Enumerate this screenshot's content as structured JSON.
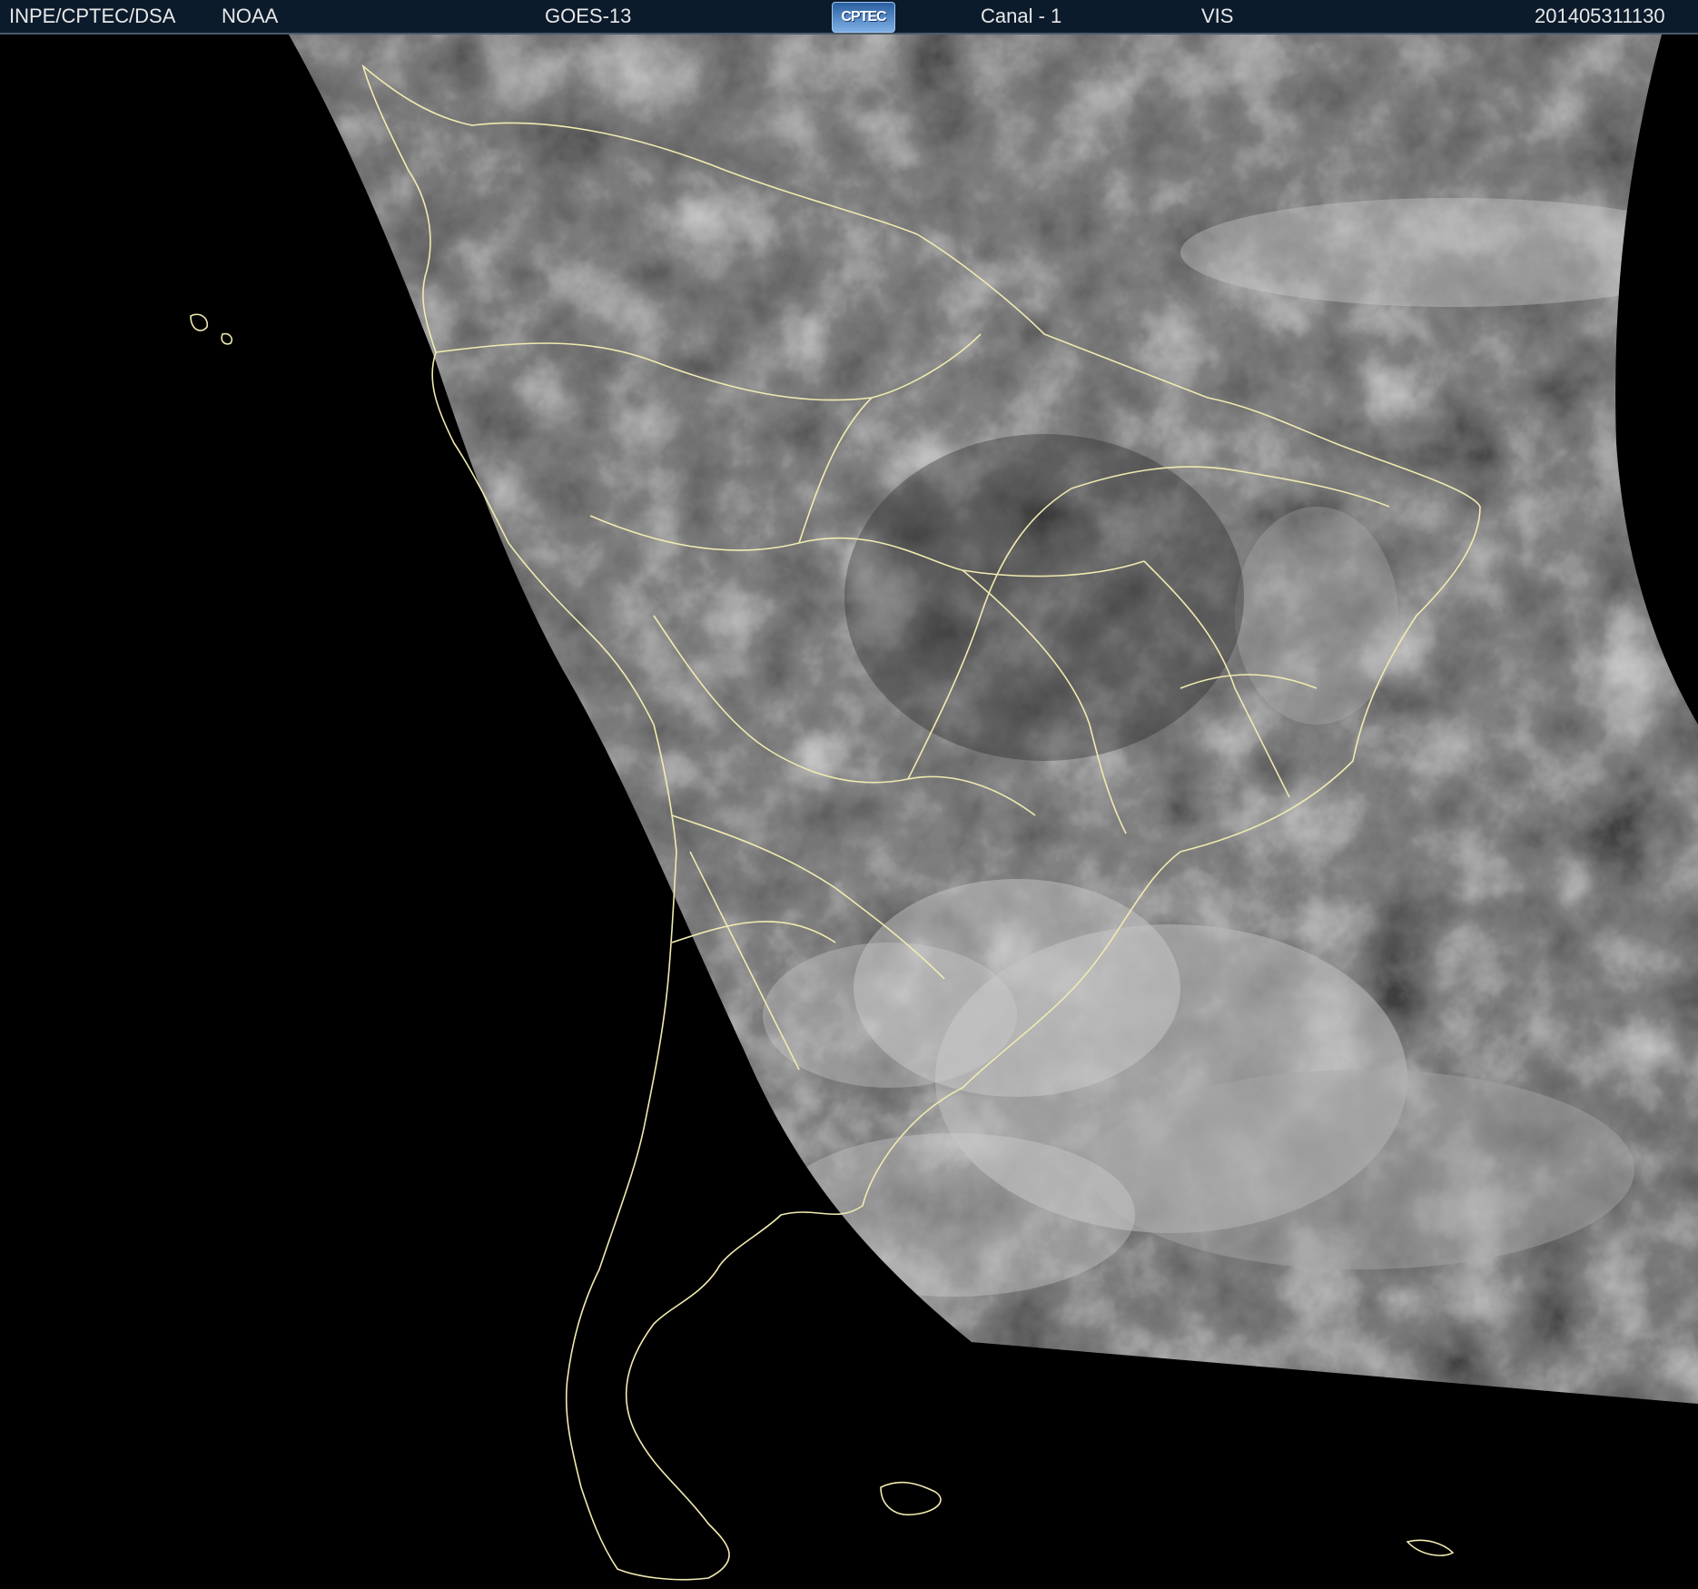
{
  "header": {
    "institution": "INPE/CPTEC/DSA",
    "agency": "NOAA",
    "satellite": "GOES-13",
    "logo_text": "CPTEC",
    "channel": "Canal - 1",
    "band": "VIS",
    "timestamp": "201405311130"
  },
  "image": {
    "description_kind": "satellite-visible-imagery",
    "coastline_color": "#f0eab0",
    "space_color": "#000000"
  }
}
